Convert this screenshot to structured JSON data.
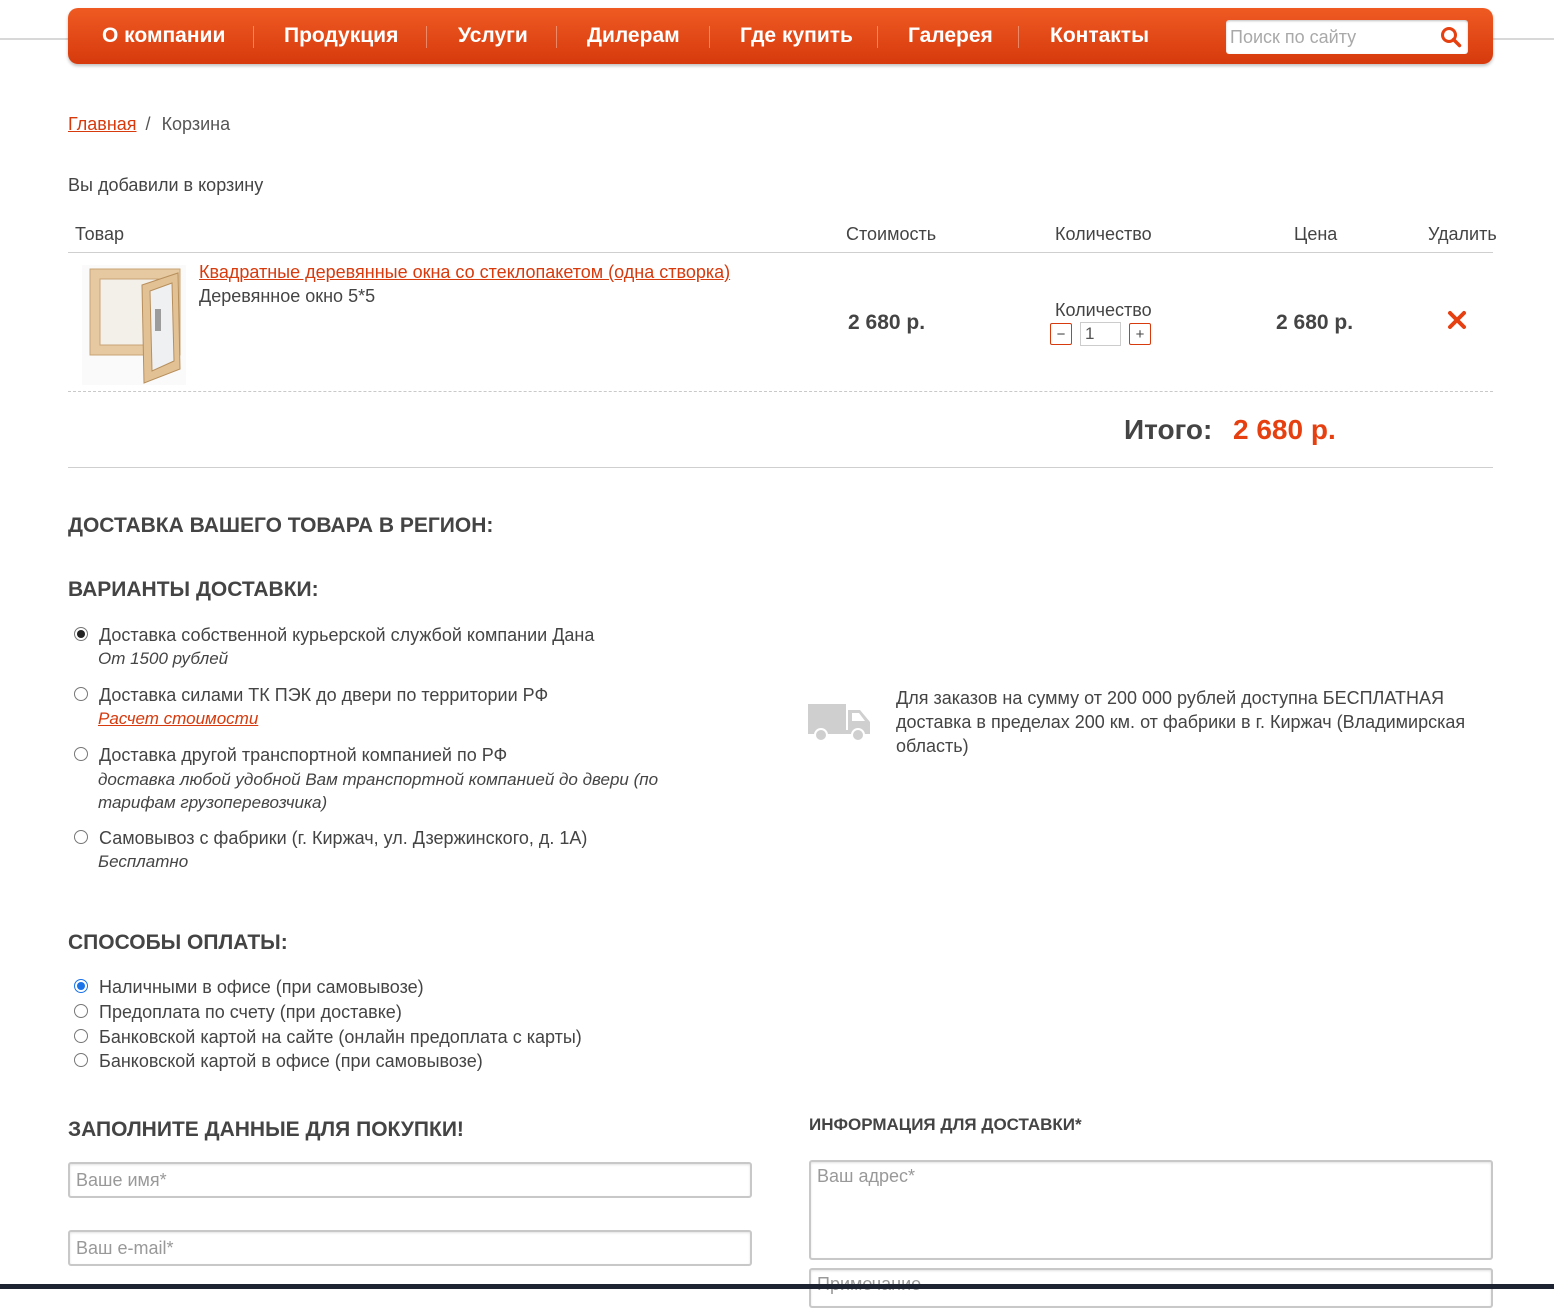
{
  "nav": {
    "items": [
      "О компании",
      "Продукция",
      "Услуги",
      "Дилерам",
      "Где купить",
      "Галерея",
      "Контакты"
    ],
    "search_placeholder": "Поиск по сайту"
  },
  "breadcrumb": {
    "home": "Главная",
    "separator": "/",
    "current": "Корзина"
  },
  "cart": {
    "intro": "Вы добавили в корзину",
    "headers": {
      "product": "Товар",
      "cost": "Стоимость",
      "quantity": "Количество",
      "price": "Цена",
      "remove": "Удалить"
    },
    "item": {
      "name": "Квадратные деревянные окна со стеклопакетом (одна створка)",
      "subtitle": "Деревянное окно 5*5",
      "cost": "2 680 р.",
      "quantity_label": "Количество",
      "quantity": "1",
      "minus": "−",
      "plus": "+",
      "price": "2 680 р."
    },
    "total_label": "Итого:",
    "total_value": "2 680 р."
  },
  "delivery": {
    "region_title": "ДОСТАВКА ВАШЕГО ТОВАРА В РЕГИОН:",
    "options_title": "ВАРИАНТЫ ДОСТАВКИ:",
    "options": [
      {
        "label": "Доставка собственной курьерской службой компании Дана",
        "note": "От 1500 рублей",
        "selected": true
      },
      {
        "label": "Доставка силами ТК ПЭК до двери по территории РФ",
        "note": "Расчет стоимости",
        "selected": false
      },
      {
        "label": "Доставка другой транспортной компанией по РФ",
        "note": "доставка любой удобной Вам транспортной компанией до двери (по тарифам грузоперевозчика)",
        "selected": false
      },
      {
        "label": "Самовывоз с фабрики (г. Киржач, ул. Дзержинского, д. 1А)",
        "note": "Бесплатно",
        "selected": false
      }
    ],
    "free_note": "Для заказов на сумму от 200 000 рублей доступна БЕСПЛАТНАЯ доставка в пределах 200 км. от фабрики в г. Киржач (Владимирская область)"
  },
  "payment": {
    "title": "СПОСОБЫ ОПЛАТЫ:",
    "options": [
      {
        "label": "Наличными в офисе (при самовывозе)",
        "selected": true
      },
      {
        "label": "Предоплата по счету (при доставке)",
        "selected": false
      },
      {
        "label": "Банковской картой на сайте (онлайн предоплата с карты)",
        "selected": false
      },
      {
        "label": "Банковской картой в офисе (при самовывозе)",
        "selected": false
      }
    ]
  },
  "form": {
    "title": "ЗАПОЛНИТЕ ДАННЫЕ ДЛЯ ПОКУПКИ!",
    "name_placeholder": "Ваше имя*",
    "email_placeholder": "Ваш e-mail*",
    "delivery_info_title": "ИНФОРМАЦИЯ ДЛЯ ДОСТАВКИ*",
    "address_placeholder": "Ваш адрес*",
    "note_placeholder": "Примечание"
  },
  "colors": {
    "accent": "#e64010",
    "nav_top": "#ef5a22",
    "nav_bottom": "#d63a0d"
  }
}
